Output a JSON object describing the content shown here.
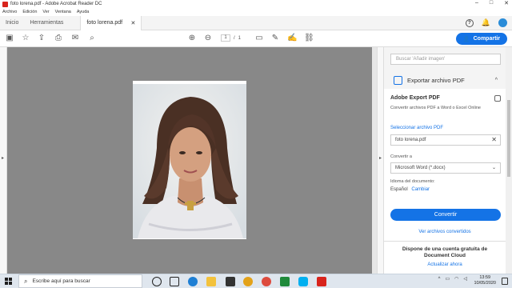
{
  "window": {
    "title": "foto lorena.pdf - Adobe Acrobat Reader DC"
  },
  "menu": [
    "Archivo",
    "Edición",
    "Ver",
    "Ventana",
    "Ayuda"
  ],
  "tabs": {
    "home": "Inicio",
    "tools": "Herramientas",
    "doc": "foto lorena.pdf"
  },
  "pager": {
    "current": "1",
    "sep": "/",
    "total": "1"
  },
  "share_label": "Compartir",
  "panel": {
    "search_placeholder": "Buscar 'Añadir imagen'",
    "section_title": "Exportar archivo PDF",
    "card_title": "Adobe Export PDF",
    "card_desc": "Convertir archivos PDF a Word o Excel Online",
    "select_label": "Seleccionar archivo PDF",
    "file_name": "foto lorena.pdf",
    "convert_to_label": "Convertir a",
    "format": "Microsoft Word (*.docx)",
    "lang_label": "Idioma del documento:",
    "lang_value": "Español",
    "lang_change": "Cambiar",
    "convert_button": "Convertir",
    "see_converted": "Ver archivos convertidos",
    "promo_text": "Dispone de una cuenta gratuita de Document Cloud",
    "promo_update": "Actualizar ahora"
  },
  "taskbar": {
    "search_placeholder": "Escribe aquí para buscar",
    "time": "13:59",
    "date": "10/05/2020"
  },
  "colors": {
    "accent": "#1473e6",
    "doc_bg": "#888888",
    "pdf_red": "#d8241c"
  }
}
